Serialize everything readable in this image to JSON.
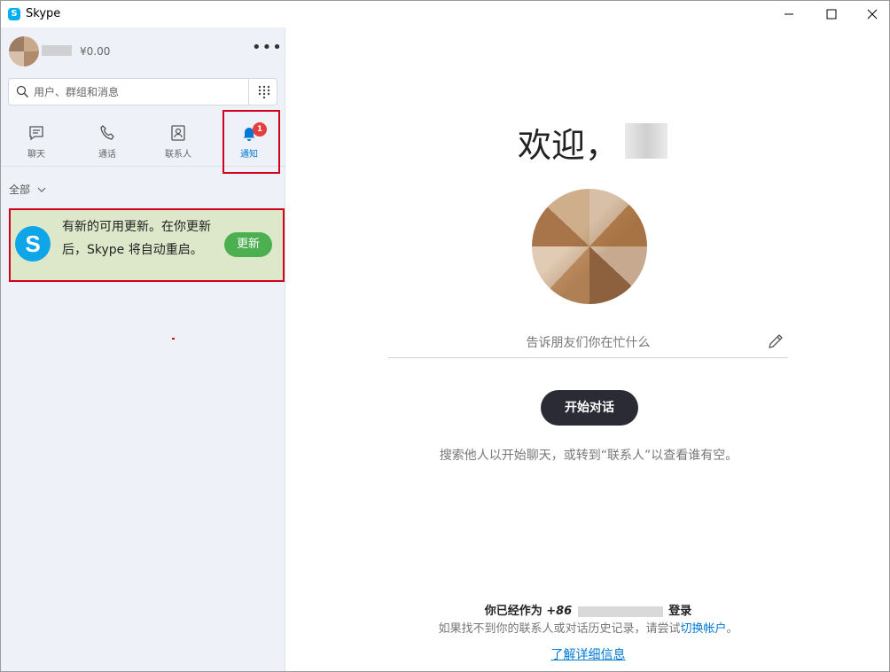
{
  "window": {
    "title": "Skype",
    "logo_letter": "S",
    "controls": [
      "minimize-icon",
      "maximize-icon",
      "close-icon"
    ]
  },
  "sidebar": {
    "profile": {
      "balance": "¥0.00"
    },
    "more_label": "•••",
    "search": {
      "placeholder": "用户、群组和消息"
    },
    "tabs": [
      {
        "label": "聊天",
        "icon": "chat-icon"
      },
      {
        "label": "通话",
        "icon": "phone-icon"
      },
      {
        "label": "联系人",
        "icon": "contacts-icon"
      },
      {
        "label": "通知",
        "icon": "bell-icon",
        "badge": "1",
        "active": true
      }
    ],
    "filter": {
      "label": "全部"
    },
    "notification": {
      "logo_letter": "S",
      "text": "有新的可用更新。在你更新后，Skype 将自动重启。",
      "button": "更新"
    }
  },
  "main": {
    "welcome": "欢迎，",
    "status_placeholder": "告诉朋友们你在忙什么",
    "start_button": "开始对话",
    "hint": "搜索他人以开始聊天，或转到“联系人”以查看谁有空。",
    "signed_in_prefix": "你已经作为",
    "signed_in_number": "+86",
    "signed_in_suffix": "登录",
    "help_text": "如果找不到你的联系人或对话历史记录，请尝试",
    "switch_account": "切换帐户",
    "help_end": "。",
    "learn_more": "了解详细信息"
  },
  "colors": {
    "accent": "#0078d4",
    "update_button": "#4caf50",
    "notification_bg": "#dde7c9",
    "highlight_border": "#d0021b",
    "badge": "#e63d3d",
    "start_button": "#2b2b36"
  }
}
